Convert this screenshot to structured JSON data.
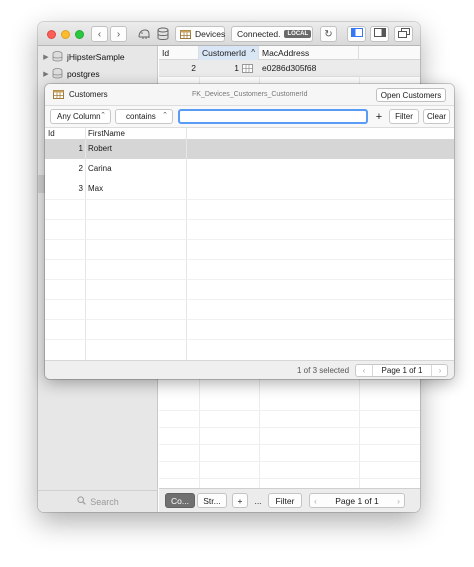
{
  "toolbar": {
    "table_name": "Devices",
    "status": "Connected.",
    "badge": "LOCAL"
  },
  "sidebar": {
    "items": [
      {
        "label": "jHipsterSample"
      },
      {
        "label": "postgres"
      }
    ],
    "search_placeholder": "Search"
  },
  "main": {
    "columns": [
      "Id",
      "CustomerId",
      "MacAddress"
    ],
    "sort_indicator": "^",
    "row": {
      "id": "2",
      "customer_id": "1",
      "mac": "e0286d305f68"
    }
  },
  "main_footer": {
    "content_tab": "Co...",
    "structure_tab": "Str...",
    "add": "+",
    "more": "...",
    "filter": "Filter",
    "page": "Page 1 of 1"
  },
  "popover": {
    "title": "Customers",
    "fk_name": "FK_Devices_Customers_CustomerId",
    "open_button": "Open Customers",
    "filter": {
      "column": "Any Column",
      "operator": "contains",
      "value": "",
      "add": "+",
      "filter_button": "Filter",
      "clear_button": "Clear"
    },
    "columns": [
      "Id",
      "FirstName"
    ],
    "rows": [
      {
        "id": "1",
        "name": "Robert"
      },
      {
        "id": "2",
        "name": "Carina"
      },
      {
        "id": "3",
        "name": "Max"
      }
    ],
    "status": "1 of 3 selected",
    "page": "Page 1 of 1"
  }
}
